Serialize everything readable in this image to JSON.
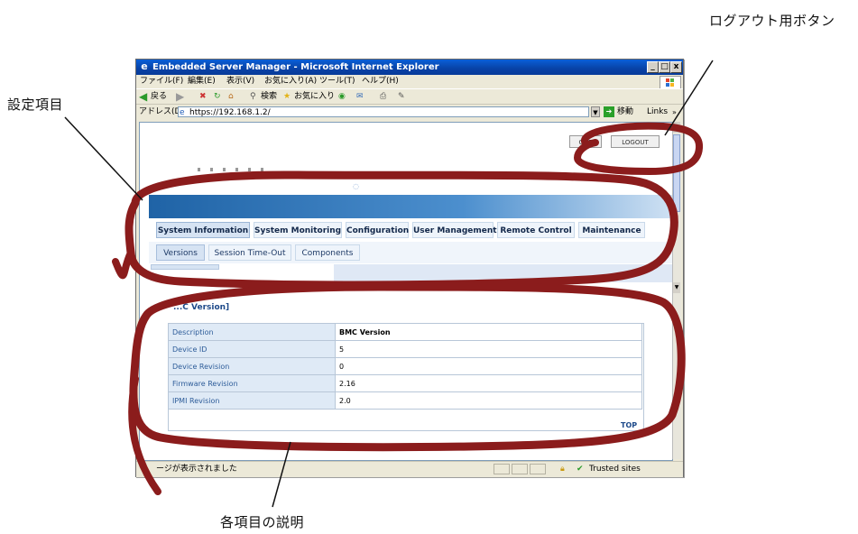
{
  "callouts": {
    "logout_label": "ログアウト用ボタン",
    "settings_label": "設定項目",
    "description_label": "各項目の説明"
  },
  "window": {
    "title": "Embedded Server Manager - Microsoft Internet Explorer",
    "minimize": "_",
    "maximize": "□",
    "close": "x"
  },
  "menu": [
    "ファイル(F)",
    "編集(E)",
    "表示(V)",
    "お気に入り(A)",
    "ツール(T)",
    "ヘルプ(H)"
  ],
  "toolbar": {
    "back": "戻る",
    "search": "検索",
    "favorites": "お気に入り"
  },
  "address": {
    "label": "アドレス(D)",
    "url": "https://192.168.1.2/",
    "go": "移動",
    "links": "Links"
  },
  "logout": {
    "partial": "OUT",
    "button": "LOGOUT"
  },
  "tabs": [
    "System Information",
    "System Monitoring",
    "Configuration",
    "User Management",
    "Remote Control",
    "Maintenance"
  ],
  "subtabs": [
    "Versions",
    "Session Time-Out",
    "Components"
  ],
  "section_title": "...C Version]",
  "table": {
    "rows": [
      {
        "label": "Description",
        "value": "BMC Version"
      },
      {
        "label": "Device ID",
        "value": "5"
      },
      {
        "label": "Device Revision",
        "value": "0"
      },
      {
        "label": "Firmware Revision",
        "value": "2.16"
      },
      {
        "label": "IPMI Revision",
        "value": "2.0"
      }
    ],
    "top_link": "TOP"
  },
  "status": {
    "text": "ージが表示されました",
    "zone": "Trusted sites"
  },
  "colors": {
    "annotation": "#8b1c1c",
    "titlebar": "#0842a6",
    "accent": "#1f63a6"
  }
}
